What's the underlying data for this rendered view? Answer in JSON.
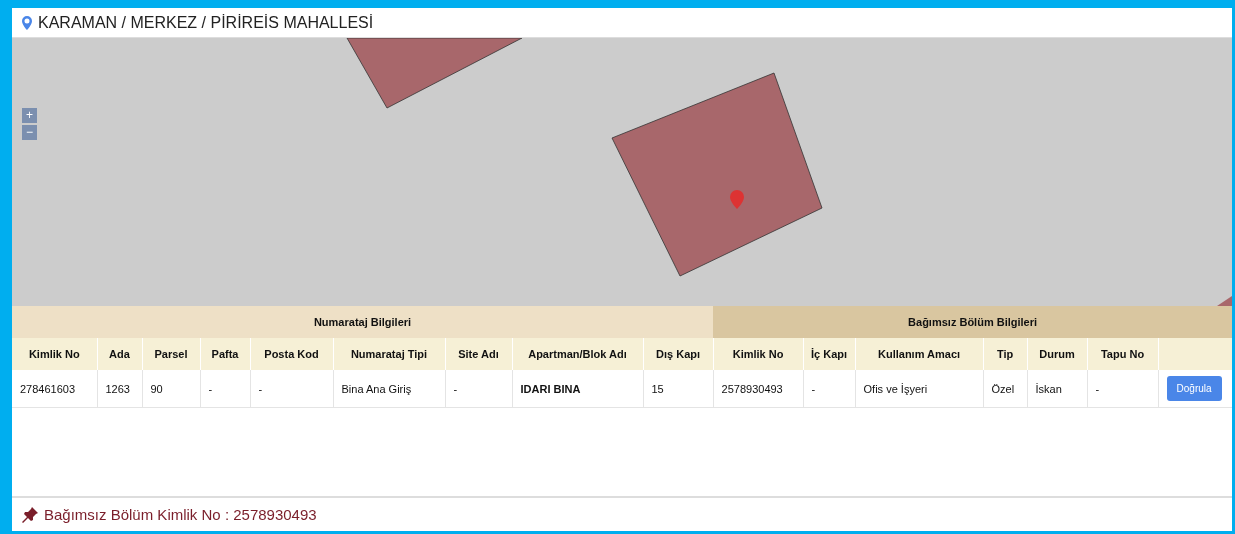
{
  "header": {
    "location": "KARAMAN / MERKEZ / PİRİREİS MAHALLESİ"
  },
  "map": {
    "zoom_buttons": [
      "+",
      "−"
    ]
  },
  "table": {
    "groups": [
      {
        "label": "Numarataj Bilgileri",
        "columns": [
          "Kimlik No",
          "Ada",
          "Parsel",
          "Pafta",
          "Posta Kod",
          "Numarataj Tipi",
          "Site Adı",
          "Apartman/Blok Adı",
          "Dış Kapı"
        ]
      },
      {
        "label": "Bağımsız Bölüm Bilgileri",
        "columns": [
          "Kimlik No",
          "İç Kapı",
          "Kullanım Amacı",
          "Tip",
          "Durum",
          "Tapu No"
        ]
      }
    ],
    "rows": [
      {
        "cells": [
          "278461603",
          "1263",
          "90",
          "-",
          "-",
          "Bina Ana Giriş",
          "-",
          "IDARI BINA",
          "15",
          "2578930493",
          "-",
          "Ofis ve İşyeri",
          "Özel",
          "İskan",
          "-"
        ],
        "action": "Doğrula"
      }
    ]
  },
  "footer": {
    "text": "Bağımsız Bölüm Kimlik No : 2578930493"
  }
}
